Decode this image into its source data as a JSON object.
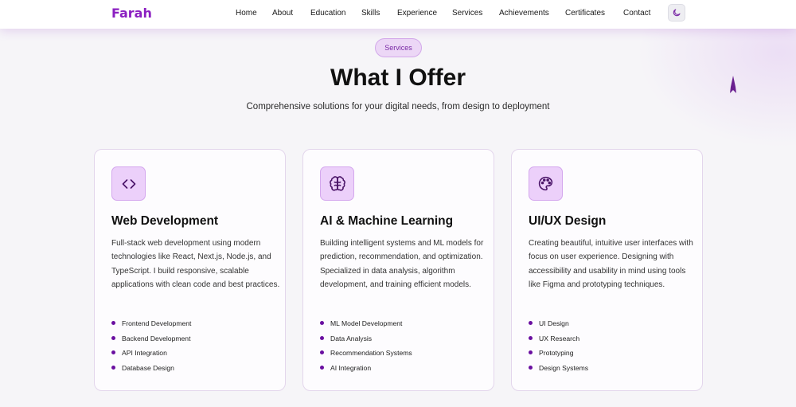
{
  "nav": {
    "brand": "Farah",
    "links": [
      "Home",
      "About",
      "Education",
      "Skills",
      "Experience",
      "Services",
      "Achievements",
      "Certificates",
      "Contact"
    ],
    "theme_toggle_icon": "moon-icon"
  },
  "section": {
    "badge": "Services",
    "title": "What I Offer",
    "subtitle": "Comprehensive solutions for your digital needs, from design to deployment"
  },
  "cards": [
    {
      "icon": "code-icon",
      "title": "Web Development",
      "description": "Full-stack web development using modern technologies like React, Next.js, Node.js, and TypeScript. I build responsive, scalable applications with clean code and best practices.",
      "items": [
        "Frontend Development",
        "Backend Development",
        "API Integration",
        "Database Design"
      ]
    },
    {
      "icon": "brain-icon",
      "title": "AI & Machine Learning",
      "description": "Building intelligent systems and ML models for prediction, recommendation, and optimization. Specialized in data analysis, algorithm development, and training efficient models.",
      "items": [
        "ML Model Development",
        "Data Analysis",
        "Recommendation Systems",
        "AI Integration"
      ]
    },
    {
      "icon": "palette-icon",
      "title": "UI/UX Design",
      "description": "Creating beautiful, intuitive user interfaces with focus on user experience. Designing with accessibility and usability in mind using tools like Figma and prototyping techniques.",
      "items": [
        "UI Design",
        "UX Research",
        "Prototyping",
        "Design Systems"
      ]
    }
  ],
  "colors": {
    "accent": "#8b1fc1",
    "badge_bg": "#ecd7f6",
    "icon_bg": "#ecd0fa",
    "bullet": "#6a0fa0"
  }
}
